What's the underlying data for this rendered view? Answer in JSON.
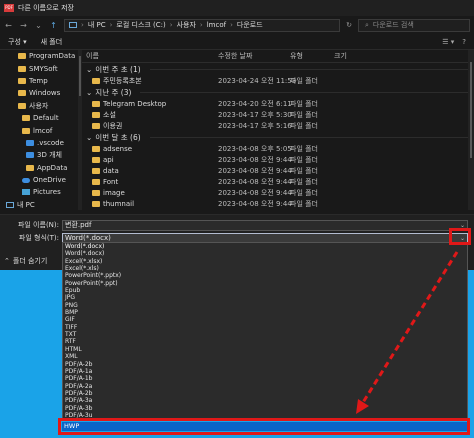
{
  "title": "다른 이름으로 저장",
  "app_icon_text": "PDF",
  "address": {
    "crumbs": [
      "내 PC",
      "로컬 디스크 (C:)",
      "사용자",
      "lmcof",
      "다운로드"
    ],
    "search_placeholder": "다운로드 검색"
  },
  "toolbar": {
    "organize": "구성 ▾",
    "new_folder": "새 폴더"
  },
  "nav": [
    {
      "label": "ProgramData",
      "icon": "folder"
    },
    {
      "label": "SMYSoft",
      "icon": "folder"
    },
    {
      "label": "Temp",
      "icon": "folder"
    },
    {
      "label": "Windows",
      "icon": "folder"
    },
    {
      "label": "사용자",
      "icon": "folder"
    },
    {
      "label": "Default",
      "icon": "folder"
    },
    {
      "label": "lmcof",
      "icon": "folder"
    },
    {
      "label": ".vscode",
      "icon": "blue"
    },
    {
      "label": "3D 개체",
      "icon": "blue"
    },
    {
      "label": "AppData",
      "icon": "folder"
    },
    {
      "label": "OneDrive",
      "icon": "cloud"
    },
    {
      "label": "Pictures",
      "icon": "pic"
    },
    {
      "label": "내 PC",
      "icon": "pc"
    }
  ],
  "columns": {
    "name": "이름",
    "date": "수정한 날짜",
    "type": "유형",
    "size": "크기"
  },
  "groups": [
    {
      "label": "이번 주 초 (1)",
      "rows": [
        {
          "name": "주민등록초본",
          "date": "2023-04-24 오전 11:53",
          "type": "파일 폴더"
        }
      ]
    },
    {
      "label": "지난 주 (3)",
      "rows": [
        {
          "name": "Telegram Desktop",
          "date": "2023-04-20 오전 6:11",
          "type": "파일 폴더"
        },
        {
          "name": "소설",
          "date": "2023-04-17 오후 5:30",
          "type": "파일 폴더"
        },
        {
          "name": "이용권",
          "date": "2023-04-17 오후 5:16",
          "type": "파일 폴더"
        }
      ]
    },
    {
      "label": "이번 달 초 (6)",
      "rows": [
        {
          "name": "adsense",
          "date": "2023-04-08 오후 5:05",
          "type": "파일 폴더"
        },
        {
          "name": "api",
          "date": "2023-04-08 오전 9:44",
          "type": "파일 폴더"
        },
        {
          "name": "data",
          "date": "2023-04-08 오전 9:44",
          "type": "파일 폴더"
        },
        {
          "name": "Font",
          "date": "2023-04-08 오전 9:44",
          "type": "파일 폴더"
        },
        {
          "name": "image",
          "date": "2023-04-08 오전 9:44",
          "type": "파일 폴더"
        },
        {
          "name": "thumnail",
          "date": "2023-04-08 오전 9:44",
          "type": "파일 폴더"
        }
      ]
    }
  ],
  "form": {
    "filename_label": "파일 이름(N):",
    "filename_value": "변환.pdf",
    "filetype_label": "파일 형식(T):",
    "filetype_value": "Word(*.docx)",
    "hide_folders": "폴더 숨기기"
  },
  "filetype_options": [
    "Word(*.docx)",
    "Word(*.docx)",
    "Excel(*.xlsx)",
    "Excel(*.xls)",
    "PowerPoint(*.pptx)",
    "PowerPoint(*.ppt)",
    "Epub",
    "JPG",
    "PNG",
    "BMP",
    "GIF",
    "TIFF",
    "TXT",
    "RTF",
    "HTML",
    "XML",
    "PDF/A-2b",
    "PDF/A-1a",
    "PDF/A-1b",
    "PDF/A-2a",
    "PDF/A-2b",
    "PDF/A-3a",
    "PDF/A-3b",
    "PDF/A-3u"
  ],
  "selected_option": "HWP",
  "colors": {
    "highlight": "#e01818",
    "selection": "#0a64c8",
    "accent": "#1aa3e8"
  }
}
